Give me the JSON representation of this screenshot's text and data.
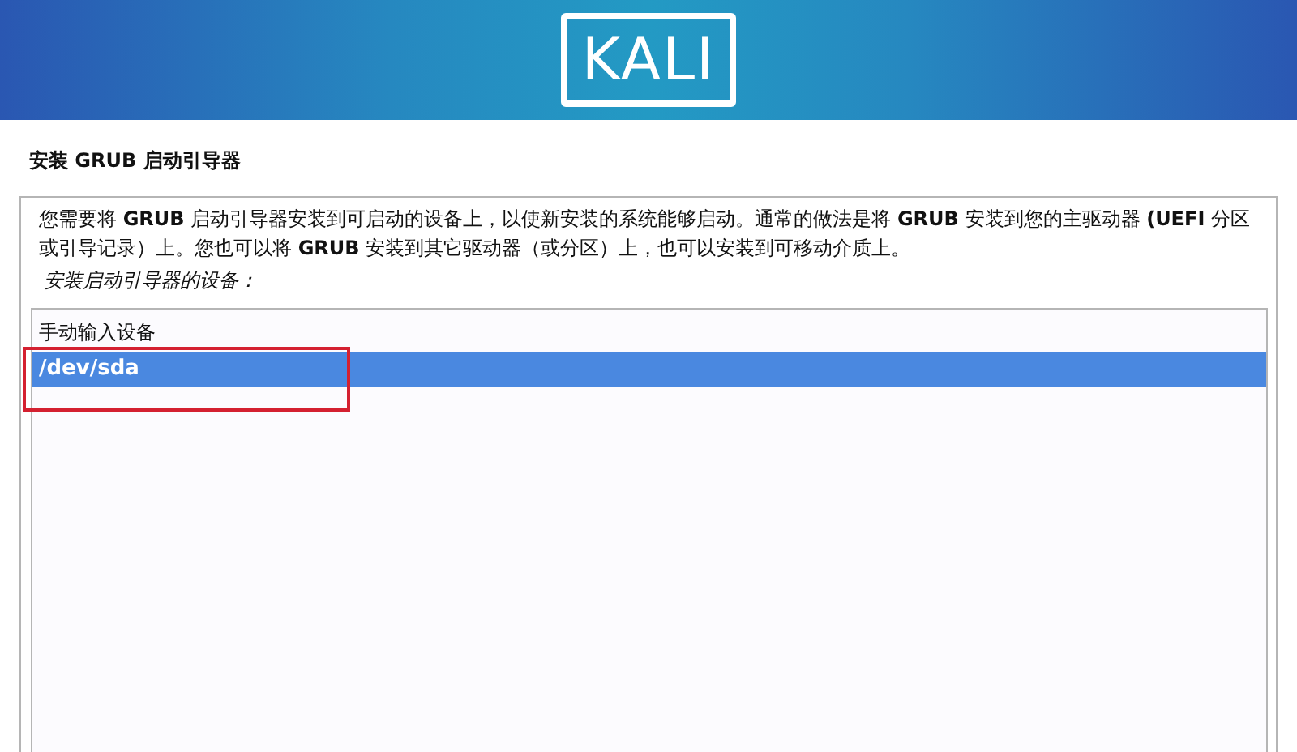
{
  "banner": {
    "logo": "KALI"
  },
  "title": "安装 GRUB 启动引导器",
  "description": "您需要将 **GRUB** 启动引导器安装到可启动的设备上，以使新安装的系统能够启动。通常的做法是将 **GRUB** 安装到您的主驱动器 **(UEFI** 分区或引导记录）上。您也可以将 **GRUB** 安装到其它驱动器（或分区）上，也可以安装到可移动介质上。",
  "prompt": "安装启动引导器的设备：",
  "devices": [
    {
      "label": "手动输入设备",
      "selected": false,
      "highlighted": false
    },
    {
      "label": "/dev/sda",
      "selected": true,
      "highlighted": true
    }
  ]
}
